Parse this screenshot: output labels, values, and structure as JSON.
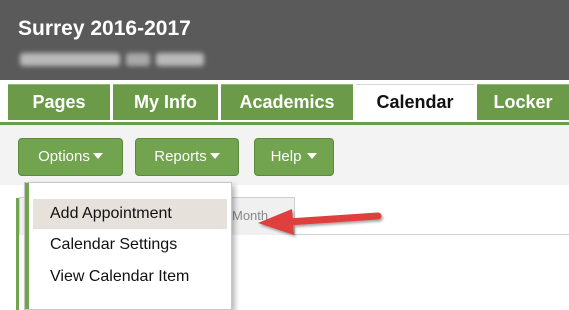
{
  "header": {
    "title": "Surrey 2016-2017"
  },
  "tabs": [
    {
      "label": "Pages"
    },
    {
      "label": "My Info"
    },
    {
      "label": "Academics"
    },
    {
      "label": "Calendar",
      "active": true
    },
    {
      "label": "Locker"
    }
  ],
  "toolbar": {
    "options_label": "Options",
    "reports_label": "Reports",
    "help_label": "Help"
  },
  "calendar_view": {
    "tab_label": "Month"
  },
  "options_menu": {
    "items": [
      {
        "label": "Add Appointment",
        "highlighted": true
      },
      {
        "label": "Calendar Settings"
      },
      {
        "label": "View Calendar Item"
      }
    ]
  },
  "colors": {
    "header_bg": "#5a5a5a",
    "accent_green": "#72a34f",
    "tab_green": "#6b9a49",
    "annotation_arrow": "#e0413e",
    "menu_highlight": "#e7e1dc"
  },
  "icons": [
    "caret-down-icon",
    "annotation-arrow-icon"
  ]
}
